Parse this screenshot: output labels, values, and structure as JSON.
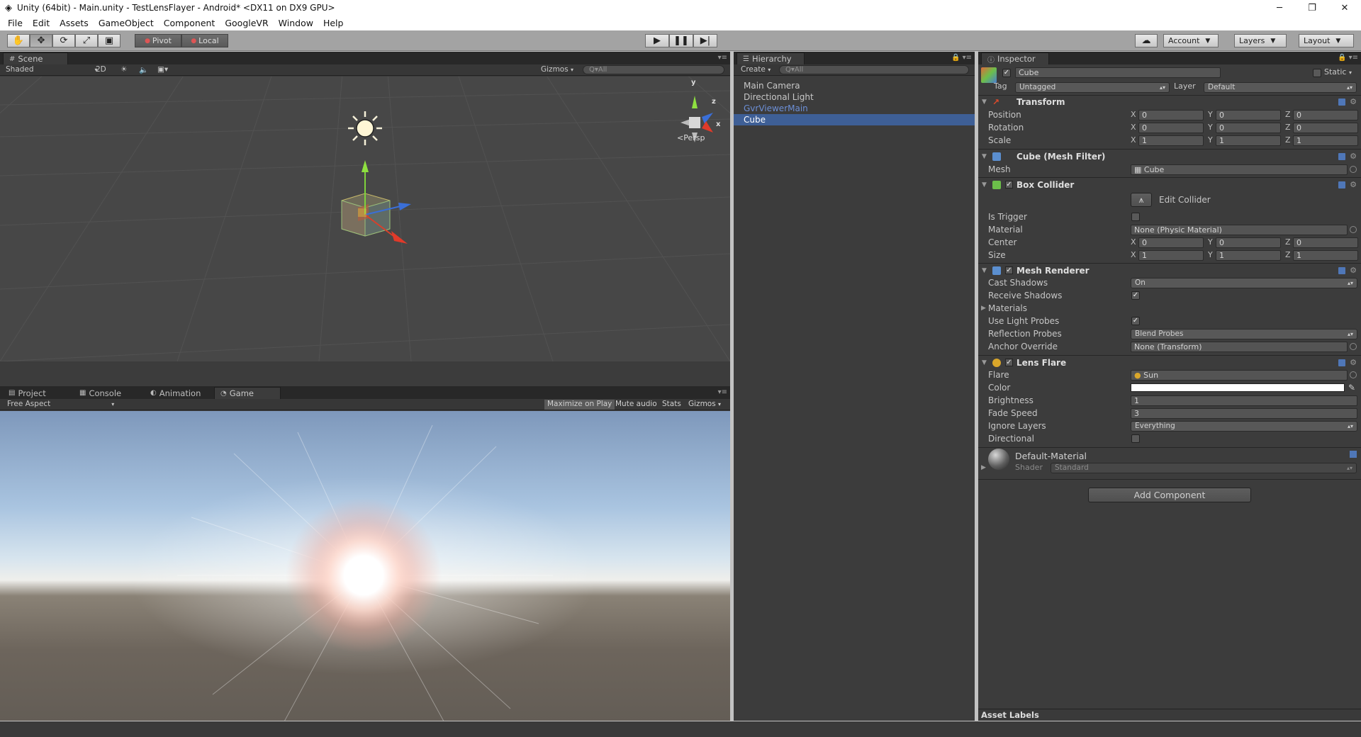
{
  "window": {
    "title": "Unity (64bit) - Main.unity - TestLensFlayer - Android* <DX11 on DX9 GPU>"
  },
  "menu": [
    "File",
    "Edit",
    "Assets",
    "GameObject",
    "Component",
    "GoogleVR",
    "Window",
    "Help"
  ],
  "toolbar": {
    "pivot": "Pivot",
    "local": "Local",
    "account": "Account",
    "layers": "Layers",
    "layout": "Layout"
  },
  "scene": {
    "tab": "Scene",
    "shading": "Shaded",
    "mode_2d": "2D",
    "gizmos": "Gizmos",
    "search_placeholder": "Q▾All",
    "persp": "Persp",
    "axis_y": "y",
    "axis_z": "z",
    "axis_x": "x"
  },
  "bottom_tabs": {
    "project": "Project",
    "console": "Console",
    "animation": "Animation",
    "game": "Game"
  },
  "game": {
    "aspect": "Free Aspect",
    "maximize": "Maximize on Play",
    "mute": "Mute audio",
    "stats": "Stats",
    "gizmos": "Gizmos"
  },
  "hierarchy": {
    "tab": "Hierarchy",
    "create": "Create",
    "search_placeholder": "Q▾All",
    "items": [
      {
        "name": "Main Camera",
        "state": "normal"
      },
      {
        "name": "Directional Light",
        "state": "normal"
      },
      {
        "name": "GvrViewerMain",
        "state": "prefab"
      },
      {
        "name": "Cube",
        "state": "selected"
      }
    ]
  },
  "inspector": {
    "tab": "Inspector",
    "object_name": "Cube",
    "static": "Static",
    "tag_label": "Tag",
    "tag_value": "Untagged",
    "layer_label": "Layer",
    "layer_value": "Default",
    "transform": {
      "title": "Transform",
      "position_label": "Position",
      "position": [
        "0",
        "0",
        "0"
      ],
      "rotation_label": "Rotation",
      "rotation": [
        "0",
        "0",
        "0"
      ],
      "scale_label": "Scale",
      "scale": [
        "1",
        "1",
        "1"
      ]
    },
    "mesh_filter": {
      "title": "Cube (Mesh Filter)",
      "mesh_label": "Mesh",
      "mesh_value": "Cube"
    },
    "box_collider": {
      "title": "Box Collider",
      "edit_collider": "Edit Collider",
      "is_trigger_label": "Is Trigger",
      "material_label": "Material",
      "material_value": "None (Physic Material)",
      "center_label": "Center",
      "center": [
        "0",
        "0",
        "0"
      ],
      "size_label": "Size",
      "size": [
        "1",
        "1",
        "1"
      ]
    },
    "mesh_renderer": {
      "title": "Mesh Renderer",
      "cast_shadows_label": "Cast Shadows",
      "cast_shadows_value": "On",
      "receive_shadows_label": "Receive Shadows",
      "materials_label": "Materials",
      "light_probes_label": "Use Light Probes",
      "reflection_probes_label": "Reflection Probes",
      "reflection_probes_value": "Blend Probes",
      "anchor_label": "Anchor Override",
      "anchor_value": "None (Transform)"
    },
    "lens_flare": {
      "title": "Lens Flare",
      "flare_label": "Flare",
      "flare_value": "Sun",
      "color_label": "Color",
      "brightness_label": "Brightness",
      "brightness_value": "1",
      "fade_label": "Fade Speed",
      "fade_value": "3",
      "ignore_label": "Ignore Layers",
      "ignore_value": "Everything",
      "directional_label": "Directional"
    },
    "material": {
      "name": "Default-Material",
      "shader_label": "Shader",
      "shader_value": "Standard"
    },
    "add_component": "Add Component",
    "asset_labels": "Asset Labels"
  },
  "axis_letters": {
    "x": "X",
    "y": "Y",
    "z": "Z"
  }
}
